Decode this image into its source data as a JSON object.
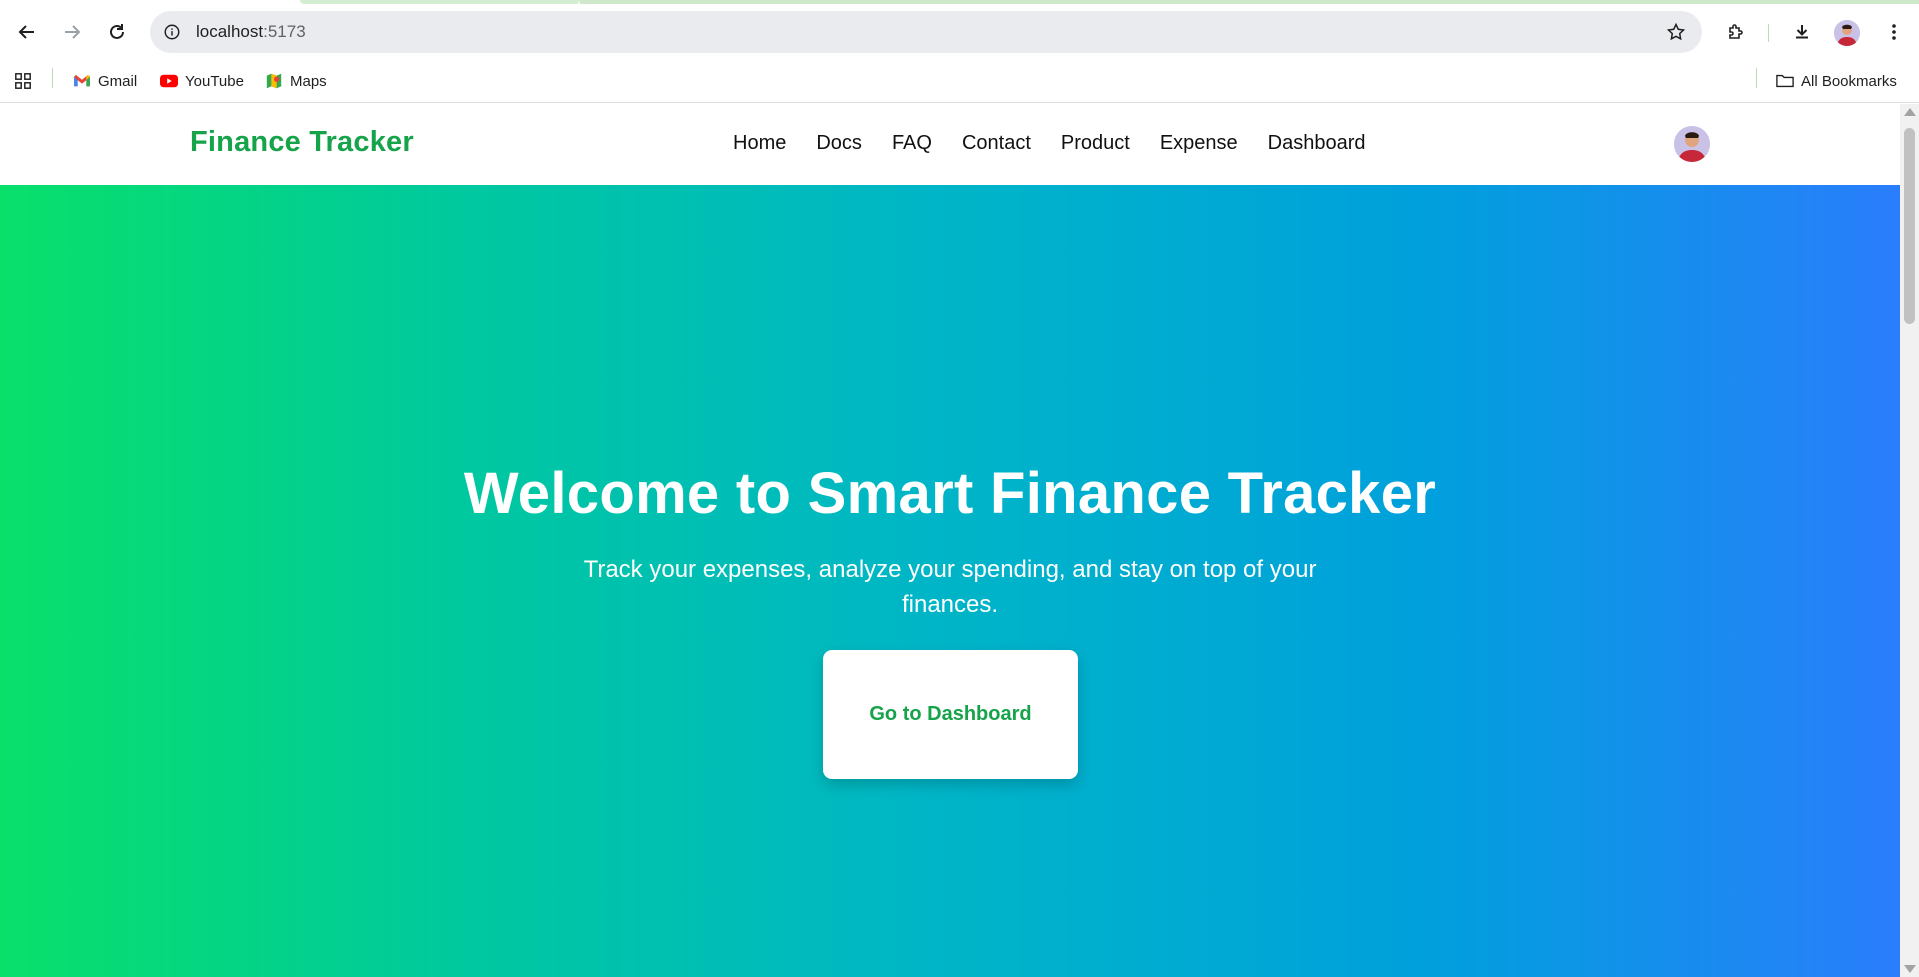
{
  "browser": {
    "url_host": "localhost",
    "url_port": ":5173",
    "bookmarks": [
      {
        "label": "Gmail",
        "icon": "gmail-icon"
      },
      {
        "label": "YouTube",
        "icon": "youtube-icon"
      },
      {
        "label": "Maps",
        "icon": "maps-icon"
      }
    ],
    "all_bookmarks_label": "All Bookmarks",
    "colors": {
      "tab_accent": "#cfe8cc",
      "omnibox_bg": "#e9ebee"
    }
  },
  "site": {
    "brand": "Finance Tracker",
    "nav": [
      "Home",
      "Docs",
      "FAQ",
      "Contact",
      "Product",
      "Expense",
      "Dashboard"
    ],
    "colors": {
      "brand": "#16a34a",
      "gradient_start": "#08e06a",
      "gradient_end": "#2a7dfc"
    }
  },
  "hero": {
    "title": "Welcome to Smart Finance Tracker",
    "subtitle": "Track your expenses, analyze your spending, and stay on top of your finances.",
    "cta_label": "Go to Dashboard"
  }
}
